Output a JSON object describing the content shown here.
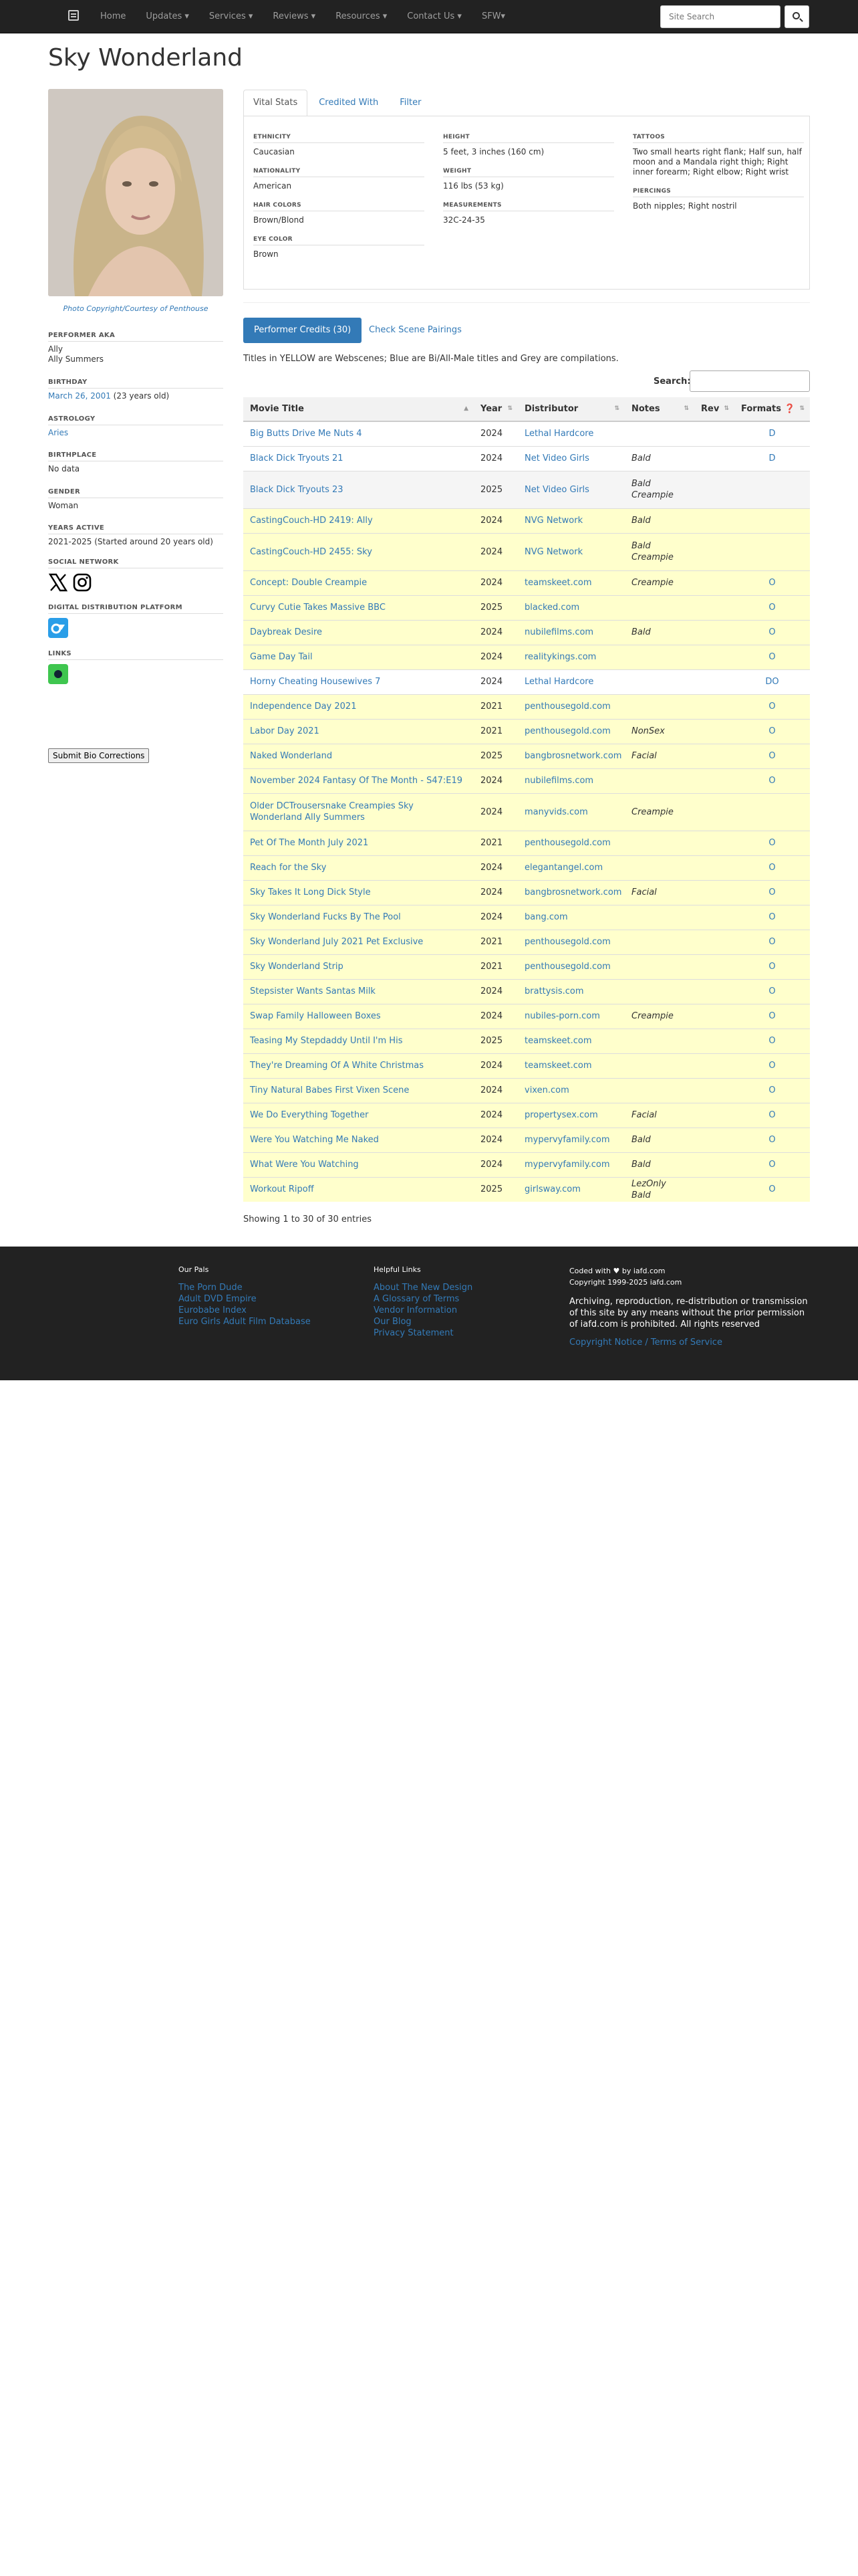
{
  "nav": {
    "items": [
      "Home",
      "Updates ▾",
      "Services ▾",
      "Reviews ▾",
      "Resources ▾",
      "Contact Us ▾",
      "SFW▾"
    ],
    "search_placeholder": "Site Search"
  },
  "performer": {
    "name": "Sky Wonderland",
    "photo_credit": "Photo Copyright/Courtesy of Penthouse",
    "aka_heading": "Performer AKA",
    "aka": [
      "Ally",
      "Ally Summers"
    ],
    "birthday_heading": "Birthday",
    "birthday_link": "March 26, 2001",
    "birthday_age": " (23 years old)",
    "astrology_heading": "Astrology",
    "astrology": "Aries",
    "birthplace_heading": "Birthplace",
    "birthplace": "No data",
    "gender_heading": "Gender",
    "gender": "Woman",
    "years_heading": "Years Active",
    "years_active": "2021-2025 (Started around 20 years old)",
    "social_heading": "Social Network",
    "distribution_heading": "Digital Distribution Platform",
    "links_heading": "Links",
    "bio_button": "Submit Bio Corrections"
  },
  "tabs": [
    "Vital Stats",
    "Credited With",
    "Filter"
  ],
  "vitals": {
    "col1": [
      {
        "label": "Ethnicity",
        "value": "Caucasian"
      },
      {
        "label": "Nationality",
        "value": "American"
      },
      {
        "label": "Hair Colors",
        "value": "Brown/Blond"
      },
      {
        "label": "Eye Color",
        "value": "Brown"
      }
    ],
    "col2": [
      {
        "label": "Height",
        "value": "5 feet, 3 inches (160 cm)"
      },
      {
        "label": "Weight",
        "value": "116 lbs (53 kg)"
      },
      {
        "label": "Measurements",
        "value": "32C-24-35"
      }
    ],
    "col3": [
      {
        "label": "Tattoos",
        "value": "Two small hearts right flank; Half sun, half moon and a Mandala right thigh; Right inner forearm; Right elbow; Right wrist"
      },
      {
        "label": "Piercings",
        "value": "Both nipples; Right nostril"
      }
    ]
  },
  "credits": {
    "button": "Performer Credits (30)",
    "pairings": "Check Scene Pairings",
    "legend": "Titles in YELLOW are Webscenes; Blue are Bi/All-Male titles and Grey are compilations.",
    "search_label": "Search:",
    "columns": [
      "Movie Title",
      "Year",
      "Distributor",
      "Notes",
      "Rev",
      "Formats ❓"
    ],
    "rows": [
      {
        "title": "Big Butts Drive Me Nuts 4",
        "year": "2024",
        "dist": "Lethal Hardcore",
        "notes": "",
        "fmt": "D",
        "style": "white",
        "h": 37
      },
      {
        "title": "Black Dick Tryouts 21",
        "year": "2024",
        "dist": "Net Video Girls",
        "notes": "Bald",
        "fmt": "D",
        "style": "white",
        "h": 37
      },
      {
        "title": "Black Dick Tryouts 23",
        "year": "2025",
        "dist": "Net Video Girls",
        "notes": "Bald Creampie",
        "fmt": "",
        "style": "grey",
        "h": 56
      },
      {
        "title": "CastingCouch-HD 2419: Ally",
        "year": "2024",
        "dist": "NVG Network",
        "notes": "Bald",
        "fmt": "",
        "style": "yellow",
        "h": 37
      },
      {
        "title": "CastingCouch-HD 2455: Sky",
        "year": "2024",
        "dist": "NVG Network",
        "notes": "Bald Creampie",
        "fmt": "",
        "style": "yellow",
        "h": 56
      },
      {
        "title": "Concept: Double Creampie",
        "year": "2024",
        "dist": "teamskeet.com",
        "notes": "Creampie",
        "fmt": "O",
        "style": "yellow",
        "h": 37
      },
      {
        "title": "Curvy Cutie Takes Massive BBC",
        "year": "2025",
        "dist": "blacked.com",
        "notes": "",
        "fmt": "O",
        "style": "yellow",
        "h": 37
      },
      {
        "title": "Daybreak Desire",
        "year": "2024",
        "dist": "nubilefilms.com",
        "notes": "Bald",
        "fmt": "O",
        "style": "yellow",
        "h": 37
      },
      {
        "title": "Game Day Tail",
        "year": "2024",
        "dist": "realitykings.com",
        "notes": "",
        "fmt": "O",
        "style": "yellow",
        "h": 37
      },
      {
        "title": "Horny Cheating Housewives 7",
        "year": "2024",
        "dist": "Lethal Hardcore",
        "notes": "",
        "fmt": "DO",
        "style": "white",
        "h": 37
      },
      {
        "title": "Independence Day 2021",
        "year": "2021",
        "dist": "penthousegold.com",
        "notes": "",
        "fmt": "O",
        "style": "yellow",
        "h": 37
      },
      {
        "title": "Labor Day 2021",
        "year": "2021",
        "dist": "penthousegold.com",
        "notes": "NonSex",
        "fmt": "O",
        "style": "yellow",
        "h": 37
      },
      {
        "title": "Naked Wonderland",
        "year": "2025",
        "dist": "bangbrosnetwork.com",
        "notes": "Facial",
        "fmt": "O",
        "style": "yellow",
        "h": 37
      },
      {
        "title": "November 2024 Fantasy Of The Month - S47:E19",
        "year": "2024",
        "dist": "nubilefilms.com",
        "notes": "",
        "fmt": "O",
        "style": "yellow",
        "h": 37
      },
      {
        "title": "Older DCTrousersnake Creampies Sky Wonderland Ally Summers",
        "year": "2024",
        "dist": "manyvids.com",
        "notes": "Creampie",
        "fmt": "",
        "style": "yellow",
        "h": 56
      },
      {
        "title": "Pet Of The Month July 2021",
        "year": "2021",
        "dist": "penthousegold.com",
        "notes": "",
        "fmt": "O",
        "style": "yellow",
        "h": 37
      },
      {
        "title": "Reach for the Sky",
        "year": "2024",
        "dist": "elegantangel.com",
        "notes": "",
        "fmt": "O",
        "style": "yellow",
        "h": 37
      },
      {
        "title": "Sky Takes It Long Dick Style",
        "year": "2024",
        "dist": "bangbrosnetwork.com",
        "notes": "Facial",
        "fmt": "O",
        "style": "yellow",
        "h": 37
      },
      {
        "title": "Sky Wonderland Fucks By The Pool",
        "year": "2024",
        "dist": "bang.com",
        "notes": "",
        "fmt": "O",
        "style": "yellow",
        "h": 37
      },
      {
        "title": "Sky Wonderland July 2021 Pet Exclusive",
        "year": "2021",
        "dist": "penthousegold.com",
        "notes": "",
        "fmt": "O",
        "style": "yellow",
        "h": 37
      },
      {
        "title": "Sky Wonderland Strip",
        "year": "2021",
        "dist": "penthousegold.com",
        "notes": "",
        "fmt": "O",
        "style": "yellow",
        "h": 37
      },
      {
        "title": "Stepsister Wants Santas Milk",
        "year": "2024",
        "dist": "brattysis.com",
        "notes": "",
        "fmt": "O",
        "style": "yellow",
        "h": 37
      },
      {
        "title": "Swap Family Halloween Boxes",
        "year": "2024",
        "dist": "nubiles-porn.com",
        "notes": "Creampie",
        "fmt": "O",
        "style": "yellow",
        "h": 37
      },
      {
        "title": "Teasing My Stepdaddy Until I'm His",
        "year": "2025",
        "dist": "teamskeet.com",
        "notes": "",
        "fmt": "O",
        "style": "yellow",
        "h": 37
      },
      {
        "title": "They're Dreaming Of A White Christmas",
        "year": "2024",
        "dist": "teamskeet.com",
        "notes": "",
        "fmt": "O",
        "style": "yellow",
        "h": 37
      },
      {
        "title": "Tiny Natural Babes First Vixen Scene",
        "year": "2024",
        "dist": "vixen.com",
        "notes": "",
        "fmt": "O",
        "style": "yellow",
        "h": 37
      },
      {
        "title": "We Do Everything Together",
        "year": "2024",
        "dist": "propertysex.com",
        "notes": "Facial",
        "fmt": "O",
        "style": "yellow",
        "h": 37
      },
      {
        "title": "Were You Watching Me Naked",
        "year": "2024",
        "dist": "mypervyfamily.com",
        "notes": "Bald",
        "fmt": "O",
        "style": "yellow",
        "h": 37
      },
      {
        "title": "What Were You Watching",
        "year": "2024",
        "dist": "mypervyfamily.com",
        "notes": "Bald",
        "fmt": "O",
        "style": "yellow",
        "h": 37
      },
      {
        "title": "Workout Ripoff",
        "year": "2025",
        "dist": "girlsway.com",
        "notes": "LezOnly Bald",
        "fmt": "O",
        "style": "yellow",
        "h": 37
      }
    ],
    "showing": "Showing 1 to 30 of 30 entries"
  },
  "footer": {
    "pals_heading": "Our Pals",
    "pals": [
      "The Porn Dude",
      "Adult DVD Empire",
      "Eurobabe Index",
      "Euro Girls Adult Film Database"
    ],
    "links_heading": "Helpful Links",
    "links": [
      "About The New Design",
      "A Glossary of Terms",
      "Vendor Information",
      "Our Blog",
      "Privacy Statement"
    ],
    "coded_prefix": "Coded with",
    "coded_suffix": "by iafd.com",
    "copyright": "Copyright 1999-2025 iafd.com",
    "notice": "Archiving, reproduction, re-distribution or transmission of this site by any means without the prior permission of iafd.com is prohibited. All rights reserved",
    "terms": "Copyright Notice / Terms of Service"
  }
}
